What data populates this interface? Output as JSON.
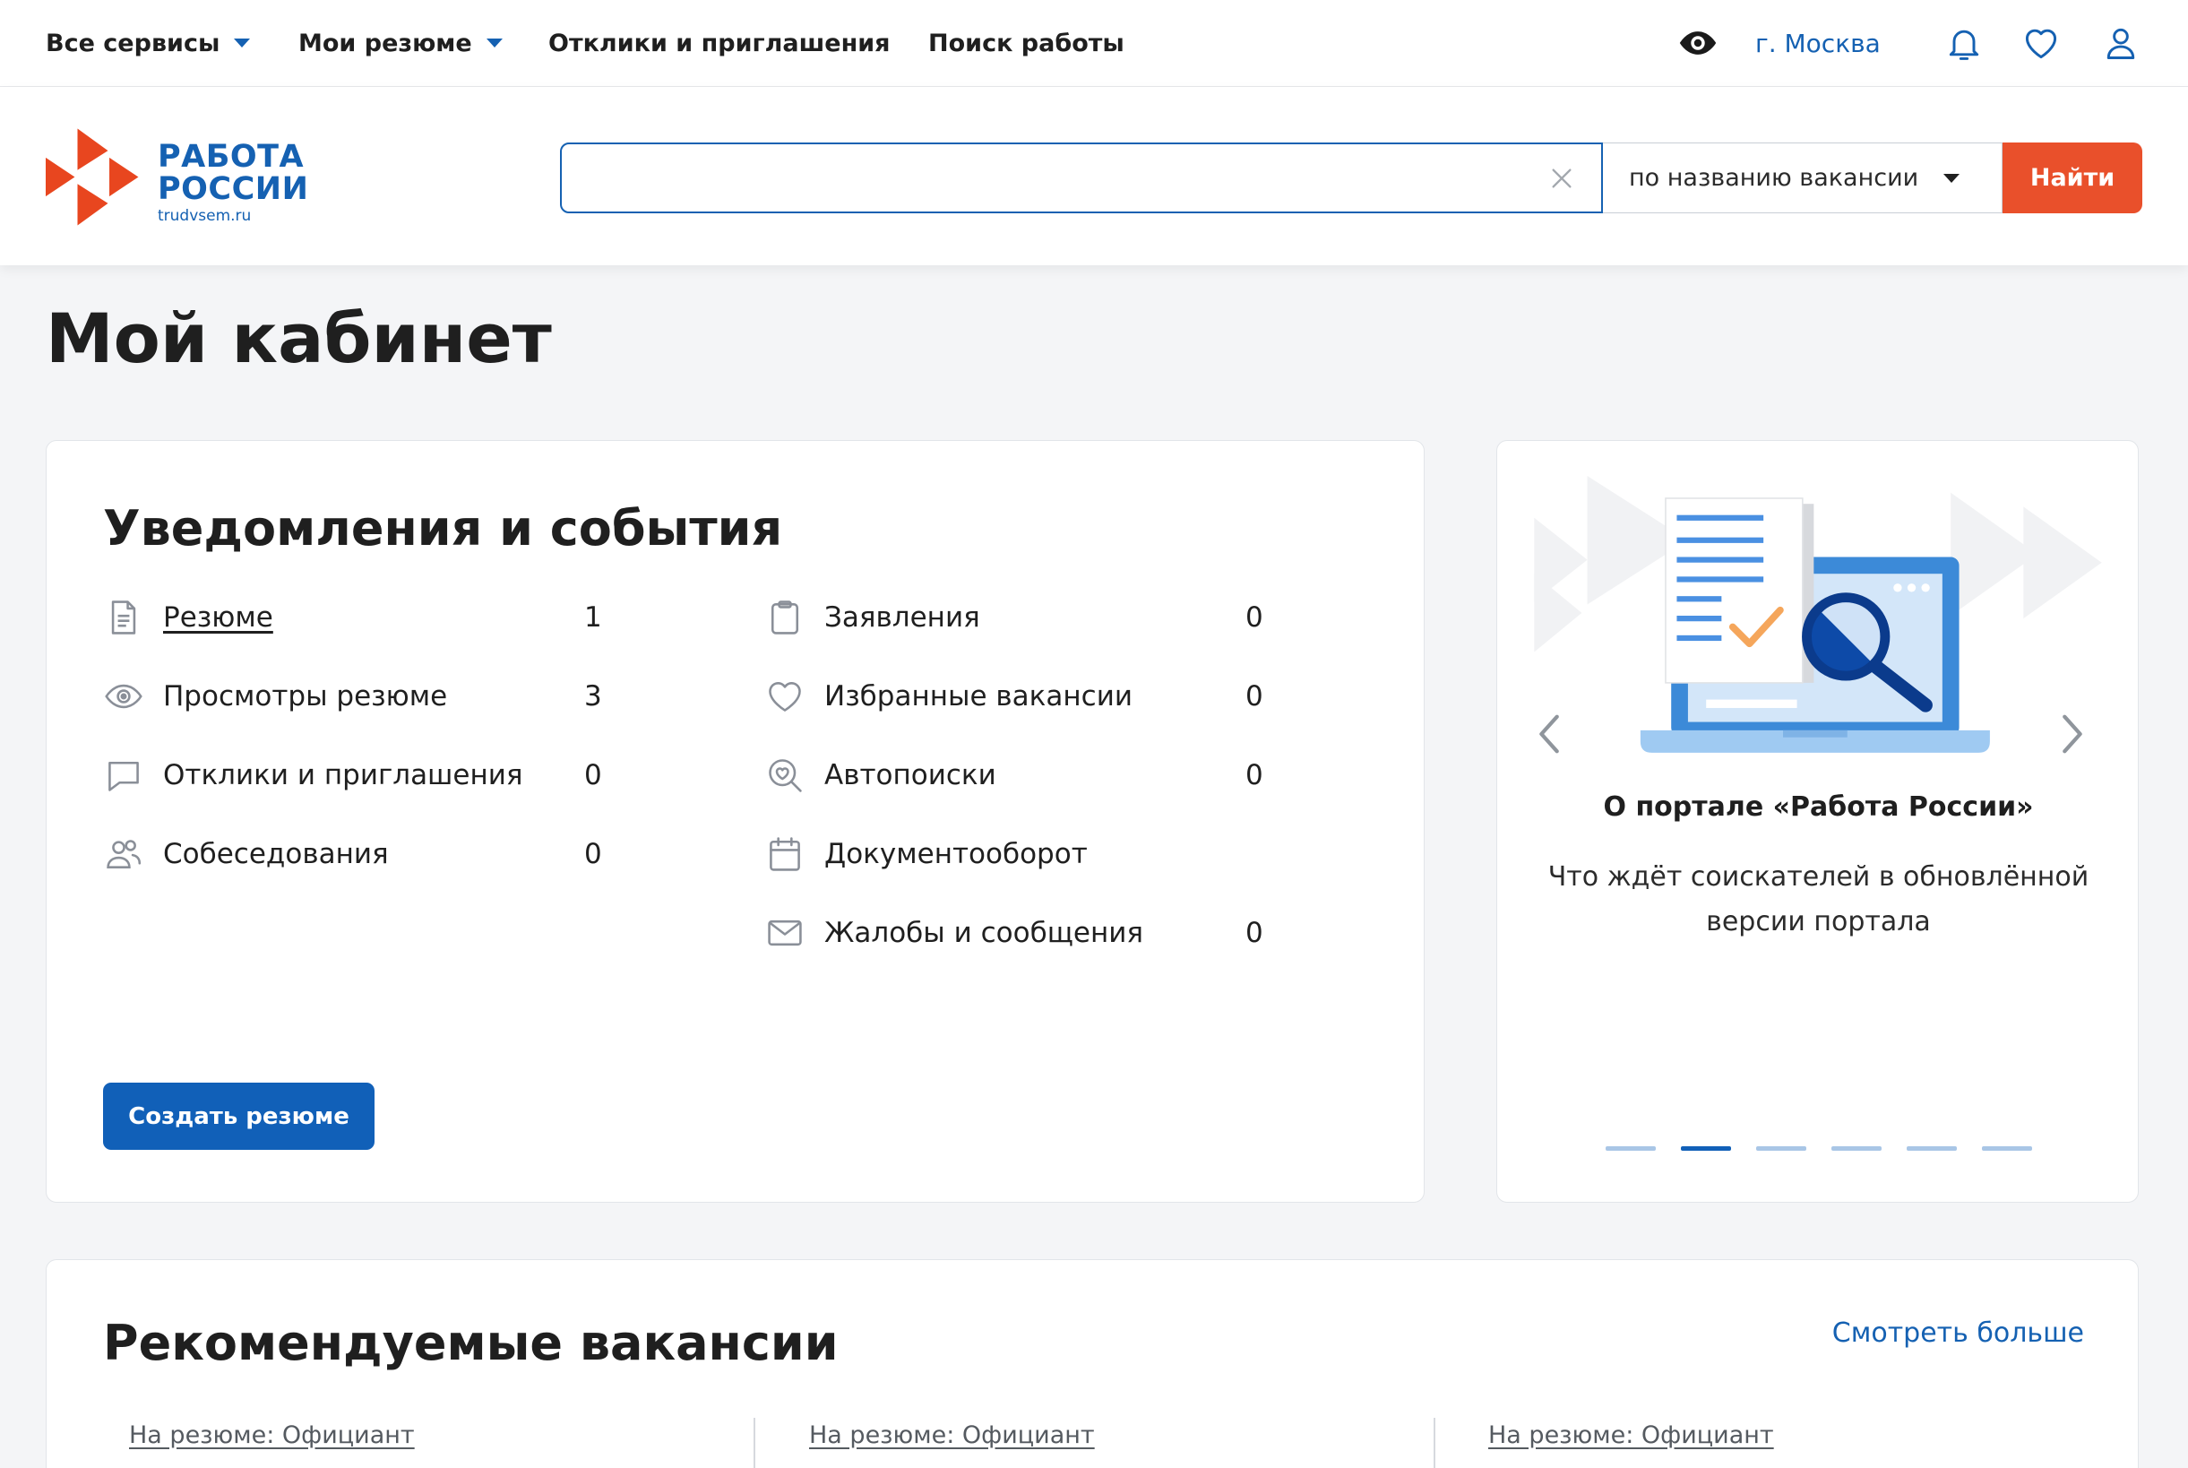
{
  "topnav": {
    "items": [
      {
        "label": "Все сервисы",
        "dropdown": true
      },
      {
        "label": "Мои резюме",
        "dropdown": true
      },
      {
        "label": "Отклики и приглашения",
        "dropdown": false
      },
      {
        "label": "Поиск работы",
        "dropdown": false
      }
    ],
    "accessibility_icon": "eye-icon",
    "city": "г. Москва",
    "actions": [
      {
        "icon": "bell-icon"
      },
      {
        "icon": "heart-icon"
      },
      {
        "icon": "user-icon"
      }
    ]
  },
  "header": {
    "logo": {
      "line1": "РАБОТА",
      "line2": "РОССИИ",
      "domain": "trudvsem.ru"
    },
    "search": {
      "value": "",
      "clear_icon": "close-icon",
      "mode": "по названию вакансии",
      "submit": "Найти"
    }
  },
  "page": {
    "title": "Мой кабинет"
  },
  "notifications": {
    "title": "Уведомления и события",
    "left": [
      {
        "icon": "document-icon",
        "label": "Резюме",
        "count": "1",
        "link": true
      },
      {
        "icon": "eye-icon",
        "label": "Просмотры резюме",
        "count": "3"
      },
      {
        "icon": "chat-icon",
        "label": "Отклики и приглашения",
        "count": "0"
      },
      {
        "icon": "users-icon",
        "label": "Собеседования",
        "count": "0"
      }
    ],
    "right": [
      {
        "icon": "clipboard-icon",
        "label": "Заявления",
        "count": "0"
      },
      {
        "icon": "heart-icon",
        "label": "Избранные вакансии",
        "count": "0"
      },
      {
        "icon": "search-heart-icon",
        "label": "Автопоиски",
        "count": "0"
      },
      {
        "icon": "calendar-icon",
        "label": "Документооборот",
        "count": null
      },
      {
        "icon": "envelope-icon",
        "label": "Жалобы и сообщения",
        "count": "0"
      }
    ],
    "create_button": "Создать резюме"
  },
  "promo": {
    "title": "О портале «Работа России»",
    "text": "Что ждёт соискателей в обновлённой версии портала",
    "slides_total": 6,
    "active_slide": 2
  },
  "recommended": {
    "title": "Рекомендуемые вакансии",
    "more_link": "Смотреть больше",
    "cards": [
      {
        "resume": "На резюме: Официант"
      },
      {
        "resume": "На резюме: Официант"
      },
      {
        "resume": "На резюме: Официант"
      }
    ]
  },
  "colors": {
    "primary": "#1561b2",
    "button": "#1160b8",
    "accent": "#e9502b",
    "background": "#f4f5f7",
    "icon_gray": "#8a8f98"
  }
}
